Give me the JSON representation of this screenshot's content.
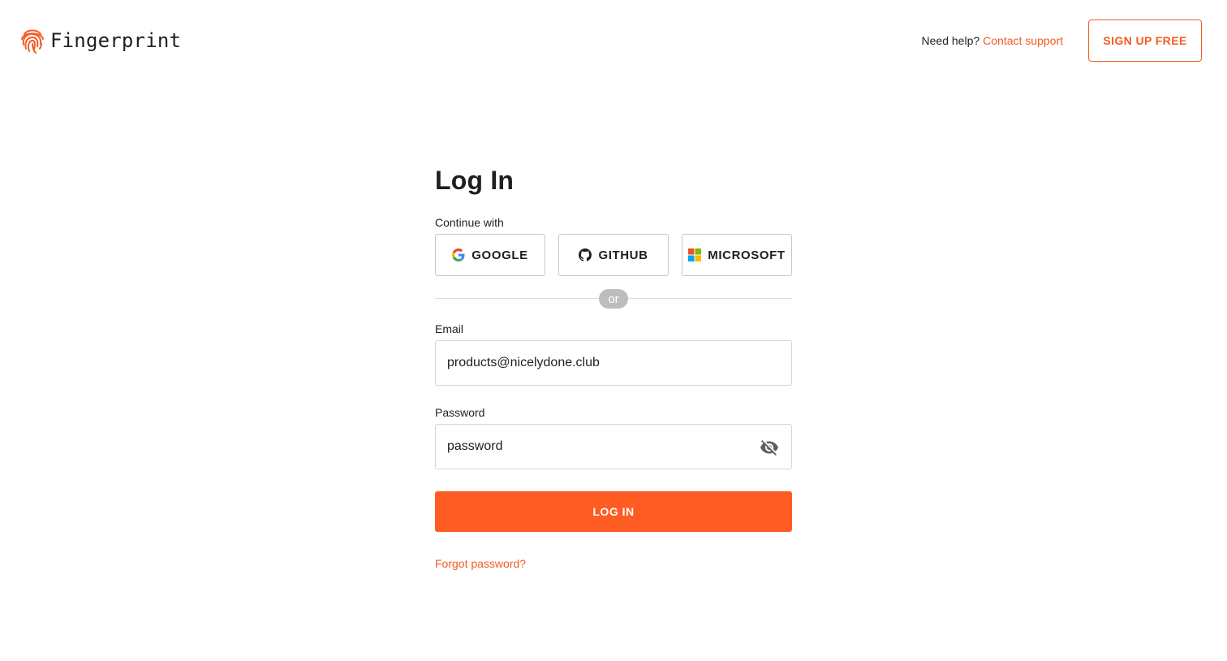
{
  "header": {
    "logo_text": "Fingerprint",
    "logo_icon": "fingerprint-icon",
    "help_text": "Need help?",
    "help_link": "Contact support",
    "signup_label": "SIGN UP FREE"
  },
  "form": {
    "title": "Log In",
    "continue_label": "Continue with",
    "sso": [
      {
        "label": "GOOGLE",
        "icon": "google-icon"
      },
      {
        "label": "GITHUB",
        "icon": "github-icon"
      },
      {
        "label": "MICROSOFT",
        "icon": "microsoft-icon"
      }
    ],
    "divider_text": "or",
    "email": {
      "label": "Email",
      "value": "products@nicelydone.club"
    },
    "password": {
      "label": "Password",
      "value": "password",
      "toggle_icon": "eye-off-icon"
    },
    "login_label": "LOG IN",
    "forgot_label": "Forgot password?"
  },
  "colors": {
    "accent": "#ff5c23",
    "link": "#f35b22",
    "border": "#d6d6d6",
    "divider_pill": "#bdbdbd"
  }
}
